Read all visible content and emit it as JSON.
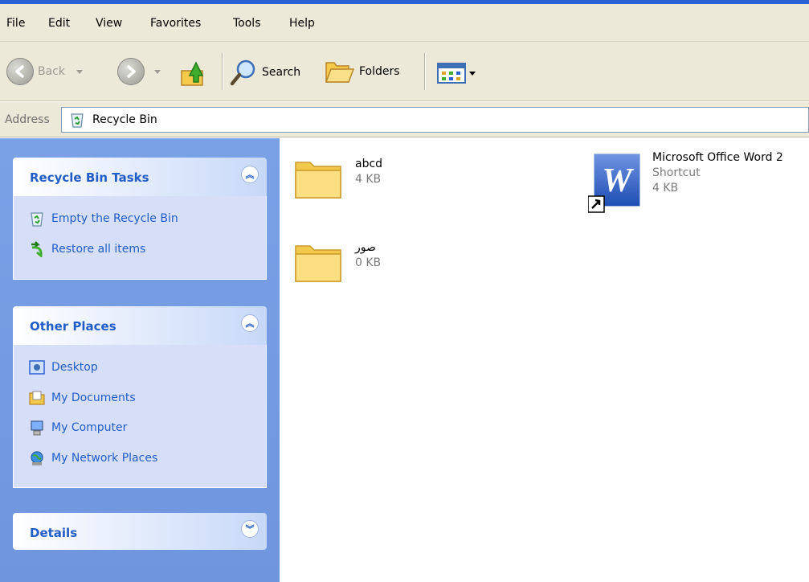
{
  "menu": [
    "File",
    "Edit",
    "View",
    "Favorites",
    "Tools",
    "Help"
  ],
  "toolbar": {
    "back_label": "Back",
    "search_label": "Search",
    "folders_label": "Folders"
  },
  "address": {
    "label": "Address",
    "value": "Recycle Bin"
  },
  "tasks_panel": {
    "title": "Recycle Bin Tasks",
    "items": [
      "Empty the Recycle Bin",
      "Restore all items"
    ]
  },
  "places_panel": {
    "title": "Other Places",
    "items": [
      "Desktop",
      "My Documents",
      "My Computer",
      "My Network Places"
    ]
  },
  "details_panel": {
    "title": "Details"
  },
  "files": [
    {
      "name": "abcd",
      "size": "4 KB",
      "icon": "folder-icon"
    },
    {
      "name": "صور",
      "size": "0 KB",
      "icon": "folder-icon"
    },
    {
      "name": "Microsoft Office Word 2",
      "type": "Shortcut",
      "size": "4 KB",
      "icon": "word-shortcut-icon"
    }
  ],
  "colors": {
    "task_pane": "#7aa1e6",
    "panel_title": "#215dc6",
    "panel_body": "#d6dff7",
    "toolbar": "#ece9d8"
  }
}
